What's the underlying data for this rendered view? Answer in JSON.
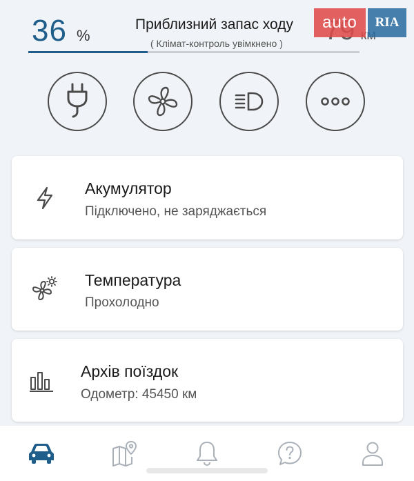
{
  "status": {
    "battery_value": "36",
    "battery_unit": "%",
    "battery_fraction": 0.36,
    "range_title": "Приблизний запас ходу",
    "range_subtitle": "( Клімат-контроль увімкнено )",
    "range_value": "79",
    "range_unit": "км"
  },
  "watermark": {
    "left": "auto",
    "right": "RIA"
  },
  "quick_actions": [
    {
      "icon": "plug-icon"
    },
    {
      "icon": "fan-icon"
    },
    {
      "icon": "headlight-icon"
    },
    {
      "icon": "more-icon"
    }
  ],
  "cards": {
    "battery": {
      "title": "Акумулятор",
      "subtitle": "Підключено, не заряджається",
      "icon": "lightning-icon"
    },
    "temperature": {
      "title": "Температура",
      "subtitle": "Прохолодно",
      "icon": "fan-sun-icon"
    },
    "trips": {
      "title": "Архів поїздок",
      "subtitle": "Одометр:  45450 км",
      "icon": "bar-chart-icon"
    }
  },
  "nav": [
    {
      "icon": "car-icon",
      "active": true
    },
    {
      "icon": "map-pin-icon",
      "active": false
    },
    {
      "icon": "bell-icon",
      "active": false
    },
    {
      "icon": "help-icon",
      "active": false
    },
    {
      "icon": "user-icon",
      "active": false
    }
  ],
  "colors": {
    "accent": "#1f5d8a",
    "background": "#f0f3f7",
    "icon_gray": "#4a4a4a",
    "nav_inactive": "#a9b0b8"
  }
}
